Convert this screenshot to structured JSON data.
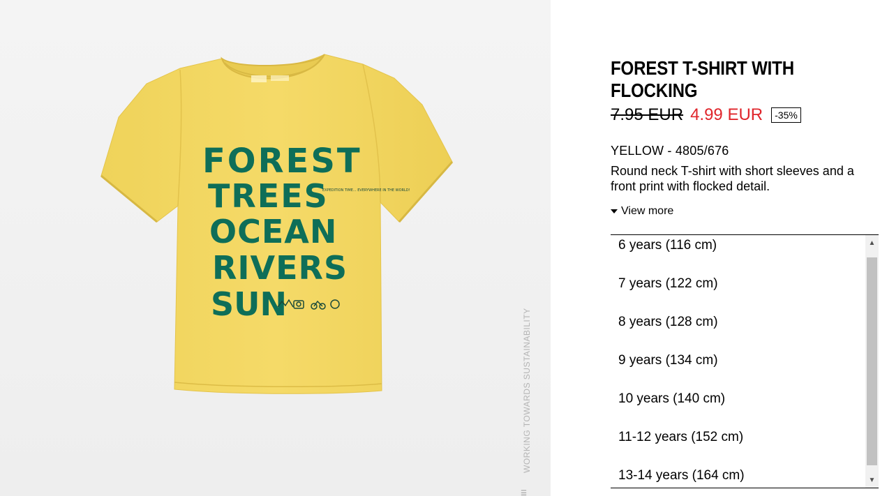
{
  "product": {
    "image_alt": "Yellow T-shirt with green print",
    "print_lines": [
      "FOREST",
      "TREES",
      "OCEAN",
      "RIVERS",
      "SUN"
    ],
    "print_small": "EXPEDITION TIME... EVERYWHERE IN THE WORLD!",
    "sustainability_caption": "WORKING TOWARDS SUSTAINABILITY",
    "title": "FOREST T-SHIRT WITH FLOCKING",
    "old_price": "7.95 EUR",
    "new_price": "4.99 EUR",
    "discount": "-35%",
    "color_ref": "YELLOW - 4805/676",
    "description": "Round neck T-shirt with short sleeves and a front print with flocked detail.",
    "view_more": "View more"
  },
  "sizes": [
    "6 years (116 cm)",
    "7 years (122 cm)",
    "8 years (128 cm)",
    "9 years (134 cm)",
    "10 years (140 cm)",
    "11-12 years (152 cm)",
    "13-14 years (164 cm)"
  ],
  "colors": {
    "shirt": "#f3d65e",
    "print": "#0e6e58",
    "sale": "#e0252b"
  }
}
